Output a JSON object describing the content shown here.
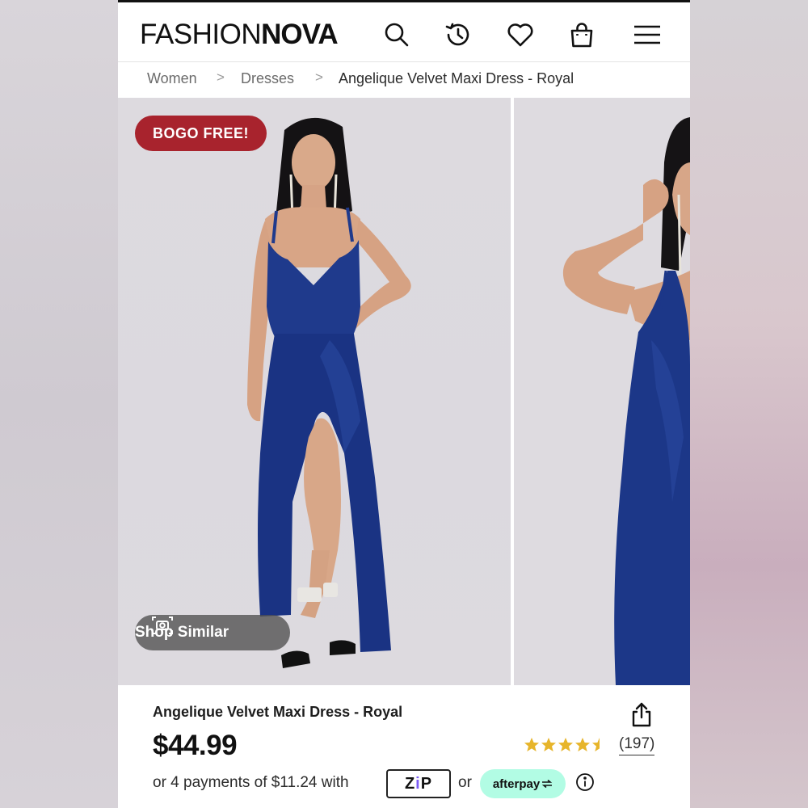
{
  "header": {
    "logo_light": "FASHION",
    "logo_bold": "NOVA",
    "icons": [
      "search-icon",
      "history-icon",
      "heart-icon",
      "bag-icon",
      "menu-icon"
    ]
  },
  "breadcrumb": {
    "items": [
      "Women",
      "Dresses",
      "Angelique Velvet Maxi Dress - Royal"
    ],
    "separator": ">"
  },
  "gallery": {
    "badge": "BOGO FREE!",
    "shop_similar": "Shop Similar",
    "dress_color": "#1f3a8c"
  },
  "product": {
    "title": "Angelique Velvet Maxi Dress - Royal",
    "price": "$44.99",
    "rating": 4.5,
    "reviews": "(197)",
    "payments_text": "or 4 payments of $11.24 with",
    "zip_label_1": "Z",
    "zip_label_2": "i",
    "zip_label_3": "P",
    "or_text": "or",
    "afterpay_label": "afterpay"
  },
  "colors": {
    "badge_red": "#a8232d",
    "afterpay_mint": "#b2fce4",
    "star_gold": "#e7b52b"
  }
}
